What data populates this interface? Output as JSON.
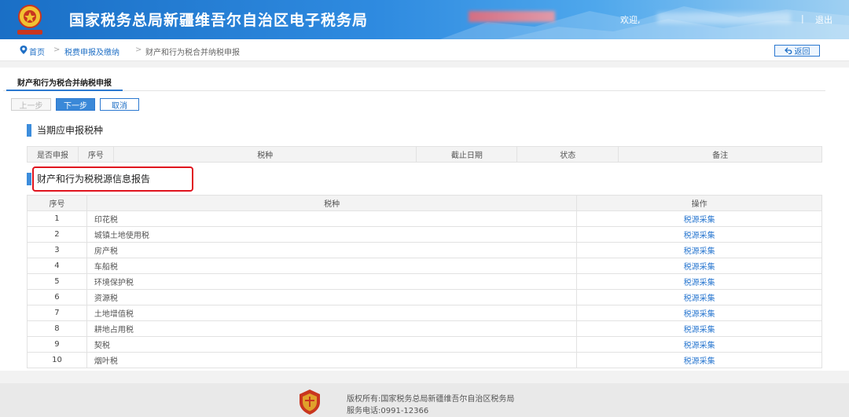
{
  "header": {
    "title": "国家税务总局新疆维吾尔自治区电子税务局",
    "welcome": "欢迎,",
    "separator": "|",
    "logout": "退出"
  },
  "breadcrumb": {
    "home": "首页",
    "arrow": ">",
    "level1": "税费申报及缴纳",
    "current": "财产和行为税合并纳税申报",
    "back": "返回"
  },
  "tab": {
    "label": "财产和行为税合并纳税申报"
  },
  "buttons": {
    "prev": "上一步",
    "next": "下一步",
    "cancel": "取消"
  },
  "section1": {
    "title": "当期应申报税种",
    "columns": [
      "是否申报",
      "序号",
      "税种",
      "截止日期",
      "状态",
      "备注"
    ]
  },
  "section2": {
    "title": "财产和行为税税源信息报告",
    "columns": [
      "序号",
      "税种",
      "操作"
    ],
    "rows": [
      {
        "no": "1",
        "tax": "印花税",
        "action": "税源采集"
      },
      {
        "no": "2",
        "tax": "城镇土地使用税",
        "action": "税源采集"
      },
      {
        "no": "3",
        "tax": "房产税",
        "action": "税源采集"
      },
      {
        "no": "4",
        "tax": "车船税",
        "action": "税源采集"
      },
      {
        "no": "5",
        "tax": "环境保护税",
        "action": "税源采集"
      },
      {
        "no": "6",
        "tax": "资源税",
        "action": "税源采集"
      },
      {
        "no": "7",
        "tax": "土地增值税",
        "action": "税源采集"
      },
      {
        "no": "8",
        "tax": "耕地占用税",
        "action": "税源采集"
      },
      {
        "no": "9",
        "tax": "契税",
        "action": "税源采集"
      },
      {
        "no": "10",
        "tax": "烟叶税",
        "action": "税源采集"
      }
    ]
  },
  "footer": {
    "copyright": "版权所有:国家税务总局新疆维吾尔自治区税务局",
    "phone": "服务电话:0991-12366"
  },
  "colors": {
    "primary": "#2b78d0",
    "highlight": "#e0141e",
    "header": "#1a6fc6"
  },
  "icons": [
    "tax-emblem-icon",
    "home-pin-icon",
    "back-arrow-icon",
    "footer-logo-icon"
  ]
}
